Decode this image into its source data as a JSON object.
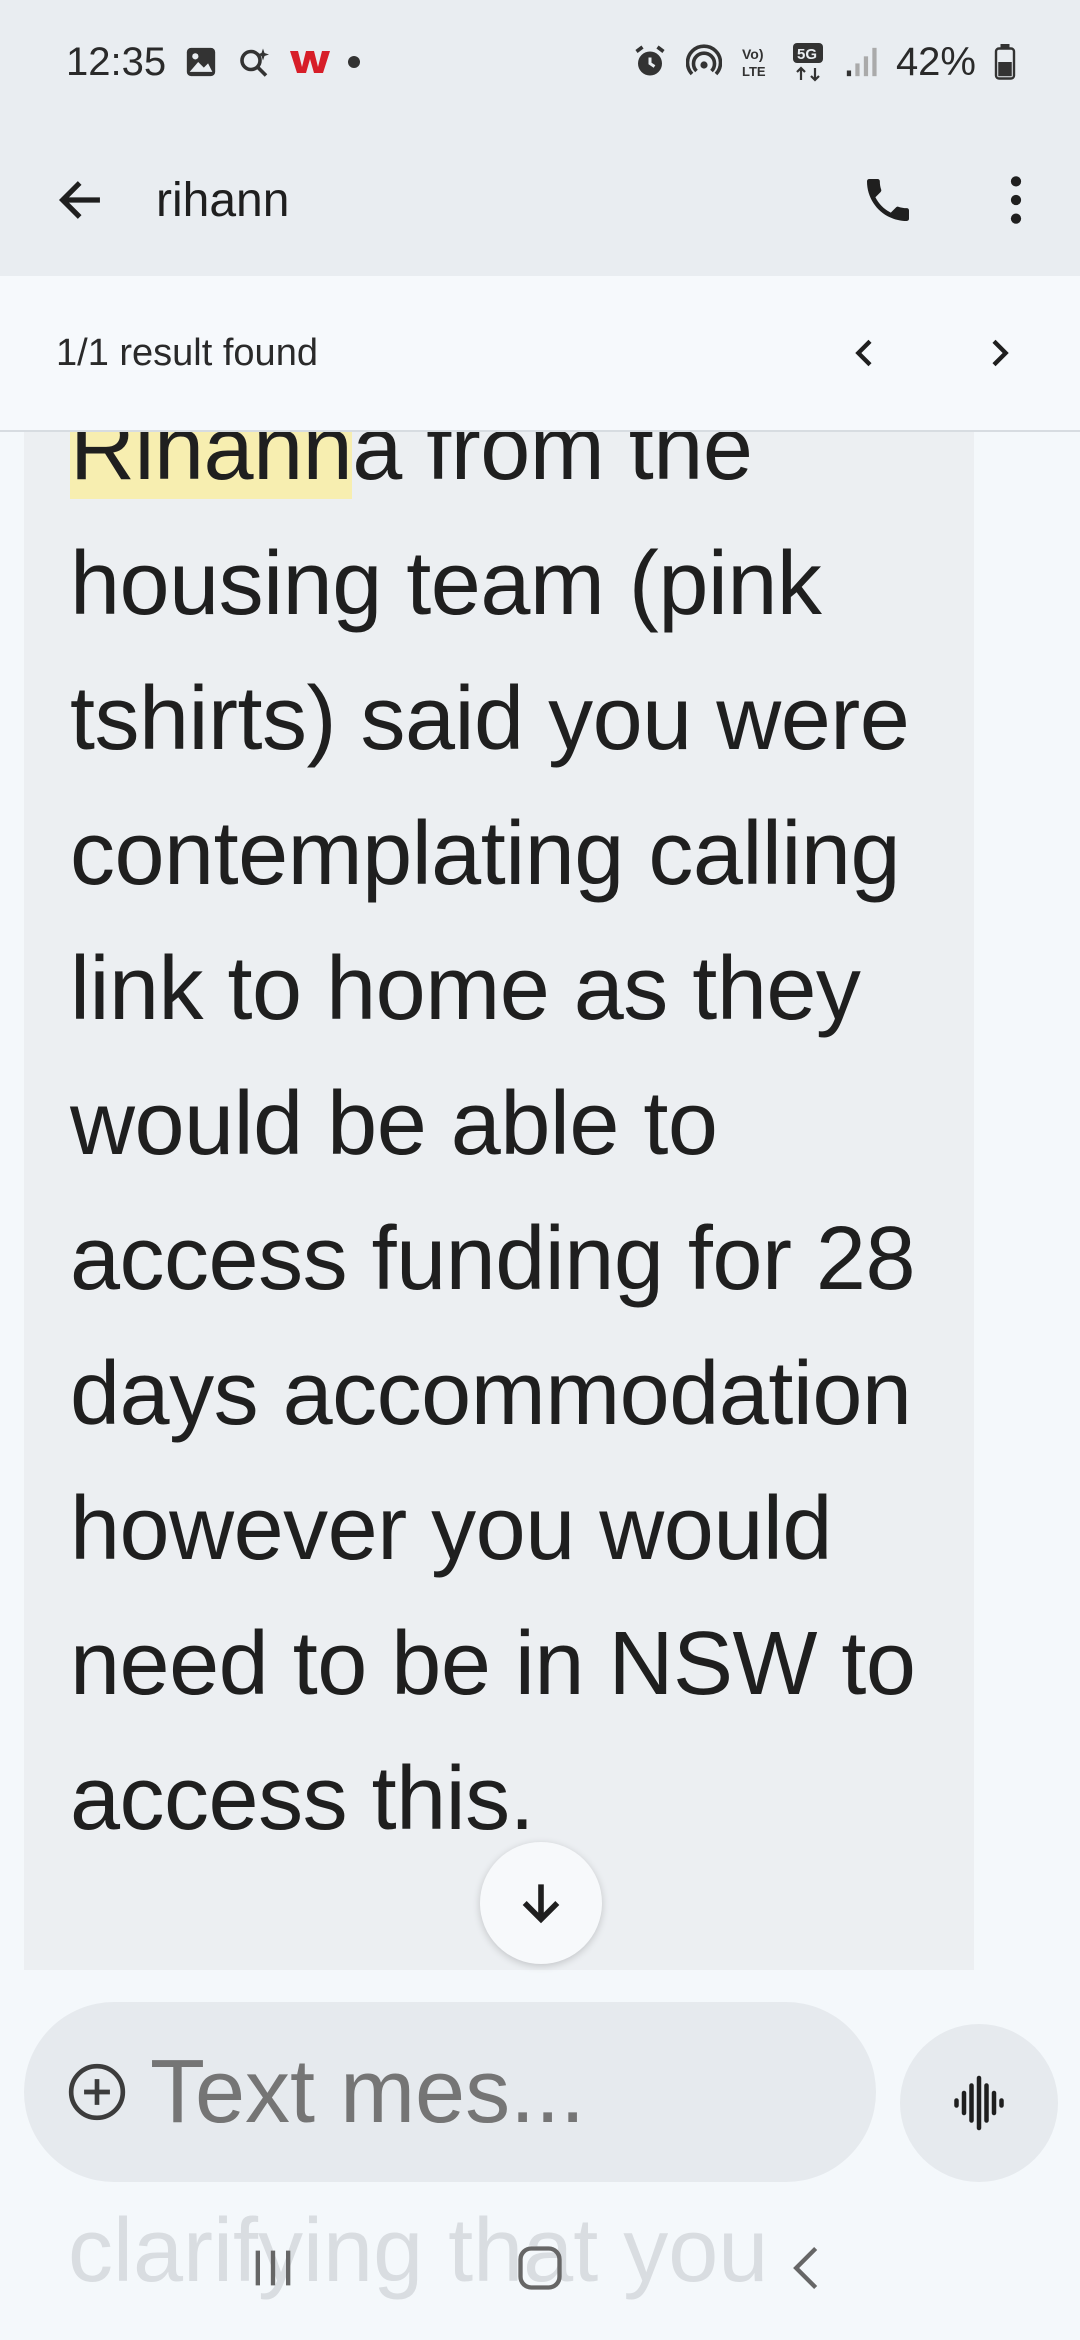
{
  "status_bar": {
    "time": "12:35",
    "battery": "42%",
    "network": "5G"
  },
  "app_bar": {
    "contact_name": "rihann"
  },
  "search": {
    "result_text": "1/1 result found"
  },
  "message": {
    "highlight": "Rihann",
    "text_after_highlight": "a from the housing team (pink tshirts) said you were contemplating calling link to home as they would be able to access funding for 28 days accommodation however you would need to be in NSW to access this."
  },
  "composer": {
    "placeholder": "Text mes..."
  },
  "faded_text": "clarifying that you",
  "colors": {
    "highlight": "#f7eeb0",
    "bubble": "#eceff2",
    "background": "#f4f8fb"
  }
}
